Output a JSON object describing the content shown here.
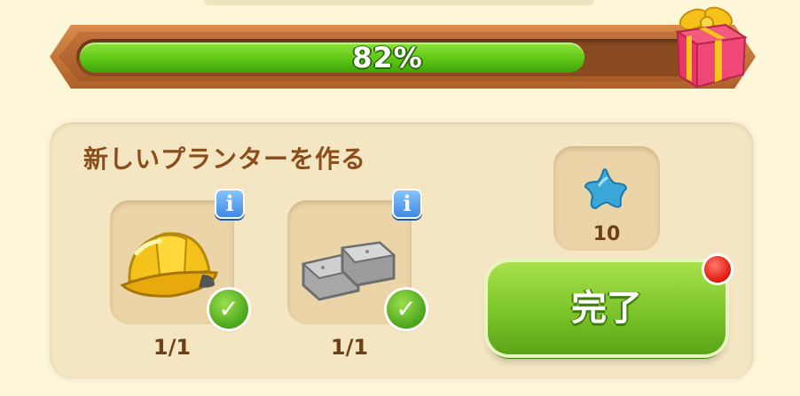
{
  "progress": {
    "percent_label": "82%",
    "value": 0.82
  },
  "reward_gift": {
    "icon": "gift-box-icon"
  },
  "task": {
    "title": "新しいプランターを作る",
    "requirements": [
      {
        "icon": "hard-hat-icon",
        "count": "1/1",
        "info_label": "i",
        "completed": true
      },
      {
        "icon": "stone-blocks-icon",
        "count": "1/1",
        "info_label": "i",
        "completed": true
      }
    ],
    "reward": {
      "icon": "blue-star-icon",
      "amount": "10"
    },
    "complete_button": {
      "label": "完了"
    }
  },
  "colors": {
    "accent_green": "#7cc42a",
    "frame_brown": "#b0612b",
    "text_brown": "#8a4e1a"
  }
}
